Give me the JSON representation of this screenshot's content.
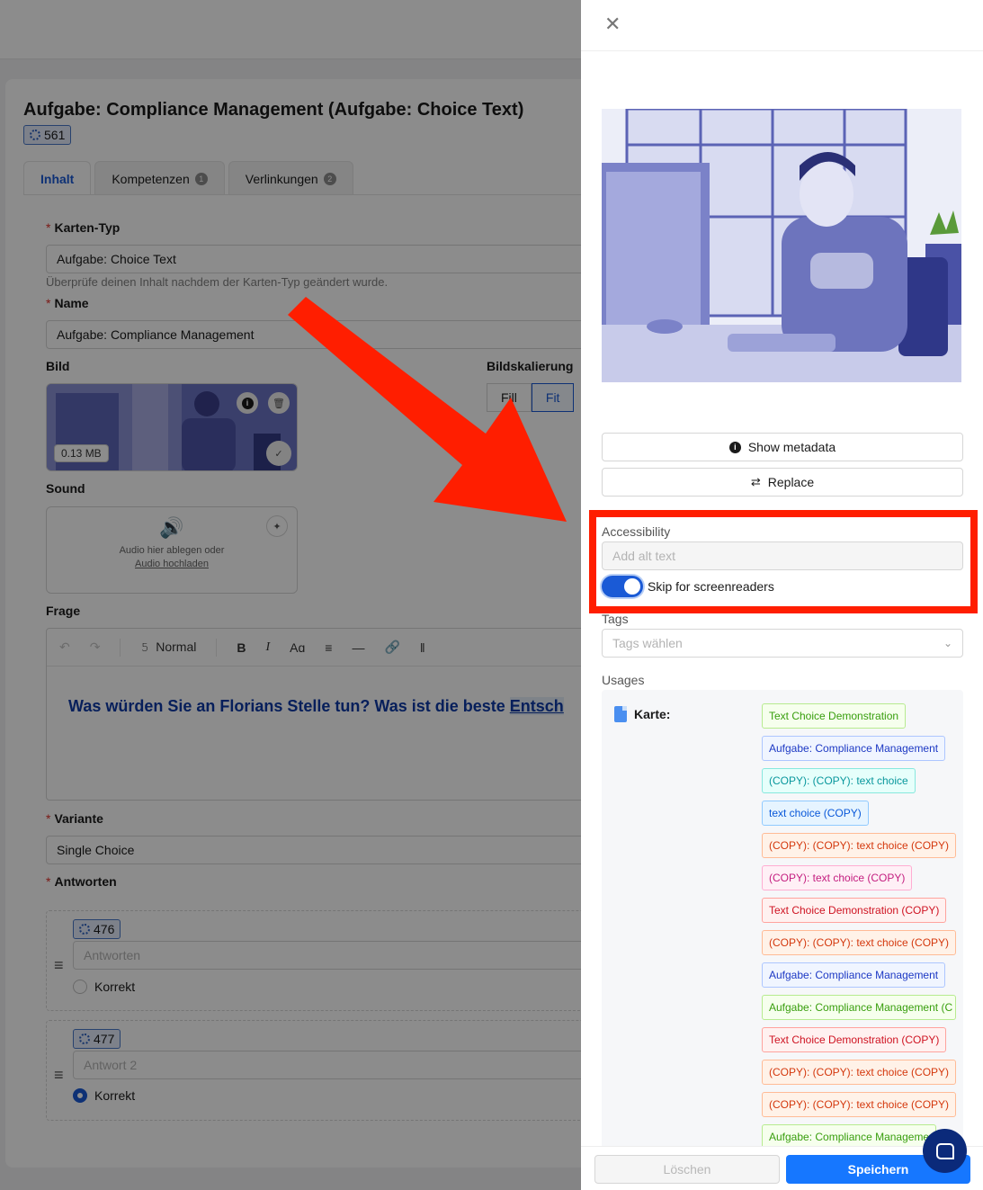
{
  "page": {
    "title": "Aufgabe: Compliance Management (Aufgabe: Choice Text)",
    "id_badge": "561",
    "tabs": [
      {
        "label": "Inhalt"
      },
      {
        "label": "Kompetenzen",
        "count": "1"
      },
      {
        "label": "Verlinkungen",
        "count": "2"
      }
    ],
    "karten_typ": {
      "label": "Karten-Typ",
      "value": "Aufgabe: Choice Text",
      "hint": "Überprüfe deinen Inhalt nachdem der Karten-Typ geändert wurde."
    },
    "name": {
      "label": "Name",
      "value": "Aufgabe: Compliance Management"
    },
    "bild": {
      "label": "Bild",
      "size": "0.13 MB"
    },
    "bildskalierung": {
      "label": "Bildskalierung",
      "options": [
        "Fill",
        "Fit"
      ],
      "selected": "Fit"
    },
    "sound": {
      "label": "Sound",
      "drop_text": "Audio hier ablegen oder",
      "upload_link": "Audio hochladen"
    },
    "frage": {
      "label": "Frage",
      "toolbar_style": "Normal",
      "text": "Was würden Sie an Florians Stelle tun? Was ist die beste ",
      "text_highlight": "Entsch"
    },
    "variante": {
      "label": "Variante",
      "value": "Single Choice"
    },
    "antworten": {
      "label": "Antworten",
      "items": [
        {
          "id": "476",
          "placeholder": "Antworten",
          "radio_label": "Korrekt",
          "checked": false
        },
        {
          "id": "477",
          "placeholder": "Antwort 2",
          "radio_label": "Korrekt",
          "checked": true
        }
      ]
    }
  },
  "drawer": {
    "show_metadata": "Show metadata",
    "replace": "Replace",
    "accessibility_label": "Accessibility",
    "alt_placeholder": "Add alt text",
    "skip_label": "Skip for screenreaders",
    "skip_enabled": true,
    "tags_label": "Tags",
    "tags_placeholder": "Tags wählen",
    "usages_label": "Usages",
    "karte_label": "Karte:",
    "usages": [
      {
        "label": "Text Choice Demonstration",
        "color": "green"
      },
      {
        "label": "Aufgabe: Compliance Management",
        "color": "blue"
      },
      {
        "label": "(COPY): (COPY): text choice",
        "color": "cyan"
      },
      {
        "label": "text choice (COPY)",
        "color": "sky"
      },
      {
        "label": "(COPY): (COPY): text choice (COPY)",
        "color": "volcano"
      },
      {
        "label": "(COPY): text choice (COPY)",
        "color": "magenta"
      },
      {
        "label": "Text Choice Demonstration (COPY)",
        "color": "red"
      },
      {
        "label": "(COPY): (COPY): text choice (COPY)",
        "color": "volcano"
      },
      {
        "label": "Aufgabe: Compliance Management",
        "color": "blue"
      },
      {
        "label": "Aufgabe: Compliance Management (C",
        "color": "green"
      },
      {
        "label": "Text Choice Demonstration (COPY)",
        "color": "red"
      },
      {
        "label": "(COPY): (COPY): text choice (COPY)",
        "color": "volcano"
      },
      {
        "label": "(COPY): (COPY): text choice (COPY)",
        "color": "volcano"
      },
      {
        "label": "Aufgabe: Compliance Manageme",
        "color": "green"
      }
    ],
    "delete_button": "Löschen",
    "save_button": "Speichern"
  },
  "colors": {
    "primary": "#1677ff",
    "annotation": "#ff1e00",
    "question_text": "#0d3aa6"
  }
}
